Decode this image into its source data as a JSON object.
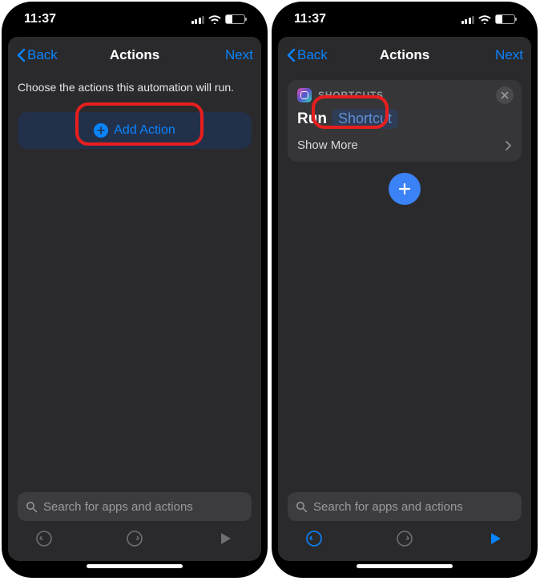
{
  "status": {
    "time": "11:37"
  },
  "nav": {
    "back": "Back",
    "title": "Actions",
    "next": "Next"
  },
  "left": {
    "instruction": "Choose the actions this automation will run.",
    "addAction": "Add Action",
    "search": "Search for apps and actions"
  },
  "right": {
    "card": {
      "appLabel": "SHORTCUTS",
      "action": "Run",
      "token": "Shortcut",
      "showMore": "Show More"
    },
    "search": "Search for apps and actions"
  }
}
